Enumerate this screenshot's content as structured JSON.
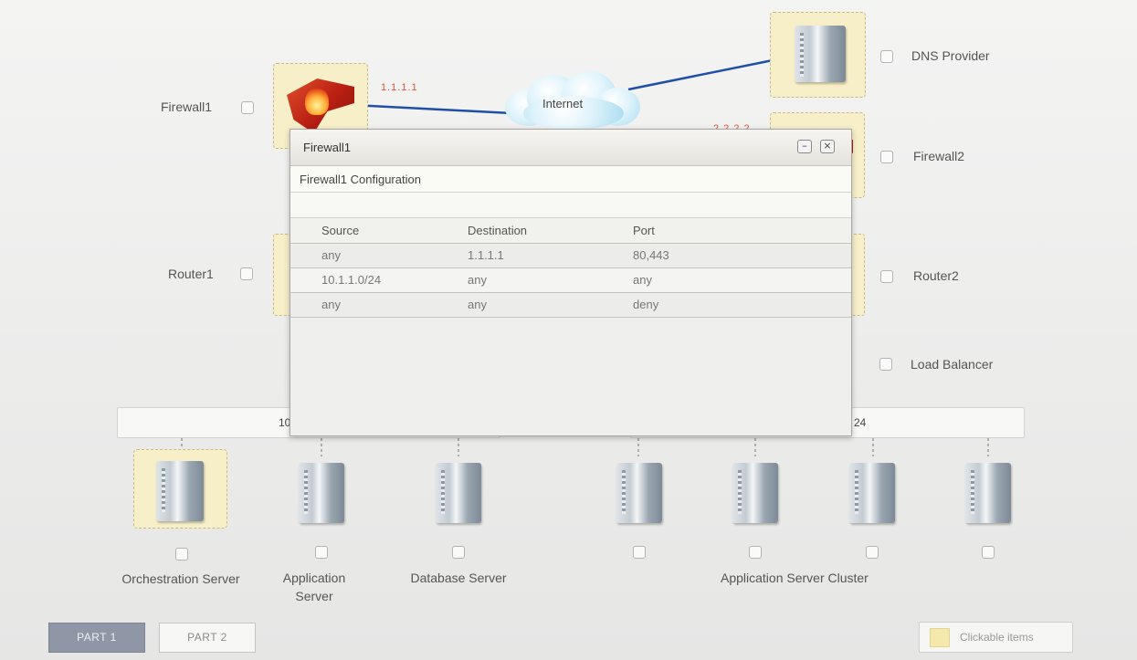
{
  "devices": {
    "firewall1": {
      "label": "Firewall1",
      "ip": "1.1.1.1"
    },
    "firewall2": {
      "label": "Firewall2",
      "ip": "2.2.2.2"
    },
    "dns": {
      "label": "DNS Provider"
    },
    "internet": {
      "label": "Internet"
    },
    "router1": {
      "label": "Router1"
    },
    "router2": {
      "label": "Router2"
    },
    "load_balancer": {
      "label": "Load Balancer"
    },
    "orchestration": {
      "label": "Orchestration Server"
    },
    "app_server": {
      "label": "Application Server"
    },
    "db_server": {
      "label": "Database Server"
    },
    "cluster": {
      "label": "Application Server Cluster"
    }
  },
  "subnets": {
    "left_partial": "10",
    "right_partial": "24"
  },
  "dialog": {
    "title": "Firewall1",
    "subtitle": "Firewall1 Configuration",
    "minimize_glyph": "–",
    "close_glyph": "×",
    "columns": [
      "Source",
      "Destination",
      "Port"
    ],
    "rows": [
      [
        "any",
        "1.1.1.1",
        "80,443"
      ],
      [
        "10.1.1.0/24",
        "any",
        "any"
      ],
      [
        "any",
        "any",
        "deny"
      ]
    ]
  },
  "footer": {
    "part1": "PART 1",
    "part2": "PART 2",
    "legend": "Clickable items"
  },
  "colors": {
    "clickable_highlight": "#f7efc8",
    "link_line": "#1f4fa8",
    "ip_label": "#e0523a",
    "active_tab": "#8f96a6"
  }
}
